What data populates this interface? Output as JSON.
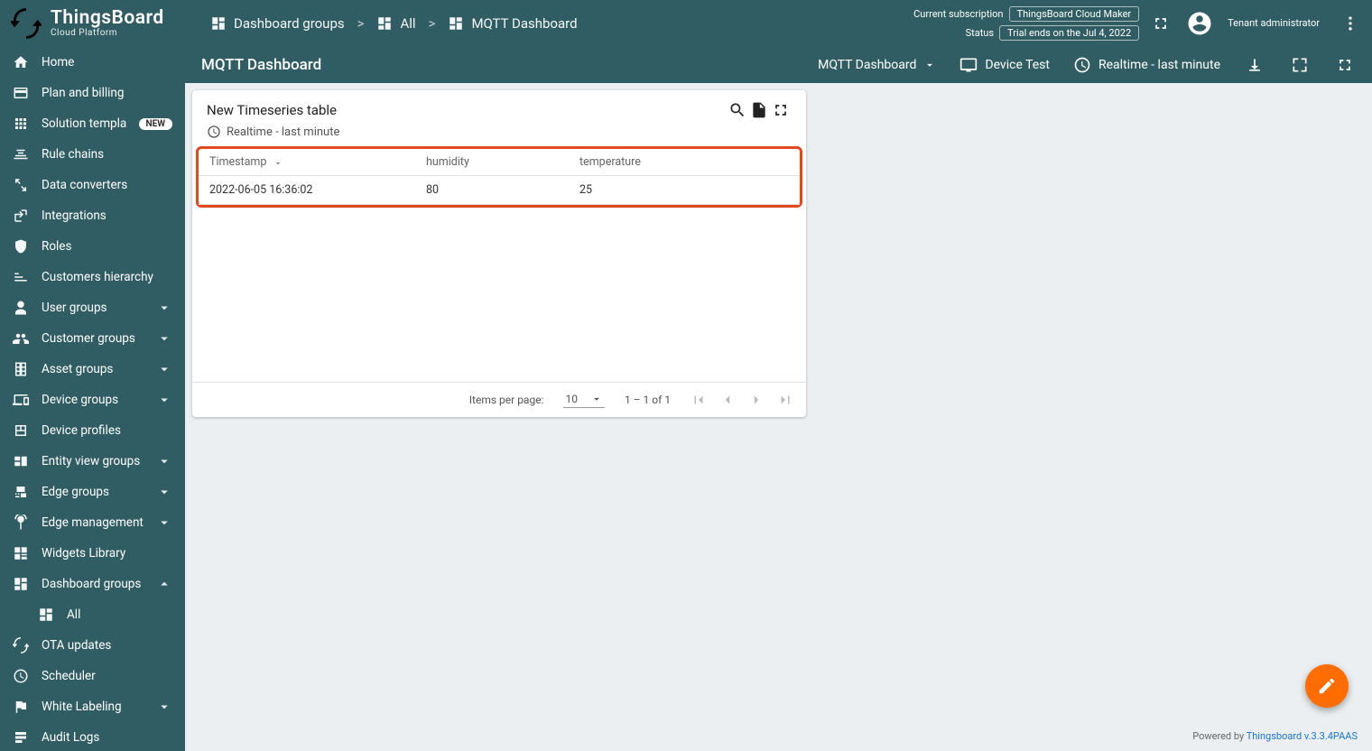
{
  "brand": {
    "name": "ThingsBoard",
    "subtitle": "Cloud Platform"
  },
  "breadcrumbs": {
    "items": [
      "Dashboard groups",
      "All",
      "MQTT Dashboard"
    ],
    "separator": ">"
  },
  "subscription": {
    "label": "Current subscription",
    "plan": "ThingsBoard Cloud Maker",
    "statusLabel": "Status",
    "statusValue": "Trial ends on the Jul 4, 2022"
  },
  "user": {
    "role": "Tenant administrator"
  },
  "sidebar": {
    "items": [
      {
        "label": "Home",
        "icon": "home"
      },
      {
        "label": "Plan and billing",
        "icon": "card"
      },
      {
        "label": "Solution templates",
        "icon": "apps",
        "badge": "NEW"
      },
      {
        "label": "Rule chains",
        "icon": "rules"
      },
      {
        "label": "Data converters",
        "icon": "convert"
      },
      {
        "label": "Integrations",
        "icon": "integration"
      },
      {
        "label": "Roles",
        "icon": "shield"
      },
      {
        "label": "Customers hierarchy",
        "icon": "hierarchy"
      },
      {
        "label": "User groups",
        "icon": "user",
        "expandable": true
      },
      {
        "label": "Customer groups",
        "icon": "users",
        "expandable": true
      },
      {
        "label": "Asset groups",
        "icon": "building",
        "expandable": true
      },
      {
        "label": "Device groups",
        "icon": "devices",
        "expandable": true
      },
      {
        "label": "Device profiles",
        "icon": "profile"
      },
      {
        "label": "Entity view groups",
        "icon": "view",
        "expandable": true
      },
      {
        "label": "Edge groups",
        "icon": "edge",
        "expandable": true
      },
      {
        "label": "Edge management",
        "icon": "antenna",
        "expandable": true
      },
      {
        "label": "Widgets Library",
        "icon": "widgets"
      },
      {
        "label": "Dashboard groups",
        "icon": "dashboard",
        "expandable": true,
        "expanded": true,
        "children": [
          {
            "label": "All",
            "icon": "dashboard"
          }
        ]
      },
      {
        "label": "OTA updates",
        "icon": "ota"
      },
      {
        "label": "Scheduler",
        "icon": "clock"
      },
      {
        "label": "White Labeling",
        "icon": "flag",
        "expandable": true
      },
      {
        "label": "Audit Logs",
        "icon": "audit"
      }
    ]
  },
  "page": {
    "title": "MQTT Dashboard"
  },
  "toolbar": {
    "dashboardSelector": "MQTT Dashboard",
    "deviceLabel": "Device Test",
    "timeWindow": "Realtime - last minute"
  },
  "widget": {
    "title": "New Timeseries table",
    "subIcon": "clock",
    "subText": "Realtime - last minute",
    "columns": [
      "Timestamp",
      "humidity",
      "temperature"
    ],
    "rows": [
      {
        "ts": "2022-06-05 16:36:02",
        "humidity": "80",
        "temperature": "25"
      }
    ],
    "pagination": {
      "itemsPerPageLabel": "Items per page:",
      "itemsPerPageValue": "10",
      "rangeLabel": "1 – 1 of 1"
    }
  },
  "footer": {
    "poweredBy": "Powered by",
    "productLink": "Thingsboard v.3.3.4PAAS"
  }
}
